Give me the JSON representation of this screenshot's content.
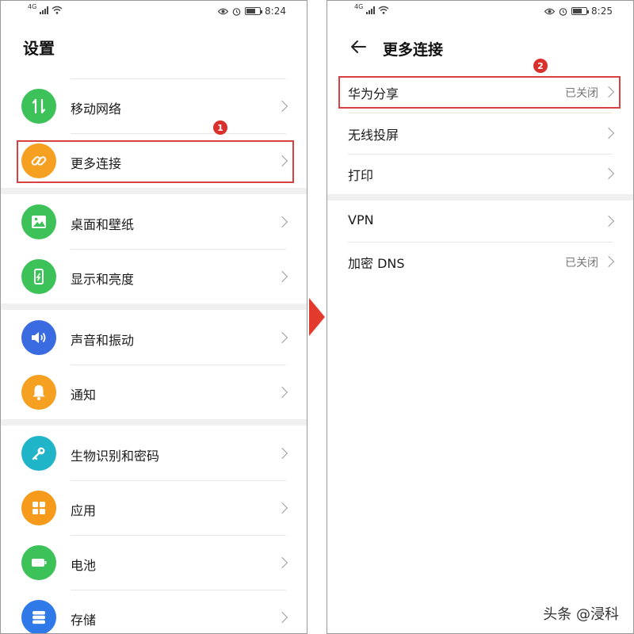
{
  "left": {
    "status": {
      "signal": "4G",
      "time": "8:24"
    },
    "title": "设置",
    "groups": [
      [
        "移动网络",
        "更多连接"
      ],
      [
        "桌面和壁纸",
        "显示和亮度"
      ],
      [
        "声音和振动",
        "通知"
      ],
      [
        "生物识别和密码",
        "应用",
        "电池",
        "存储"
      ]
    ],
    "icon_colors": {
      "mobile": "#3dc25a",
      "more": "#f5a020",
      "wallpaper": "#3dc25a",
      "display": "#3dc25a",
      "sound": "#3b6be0",
      "notify": "#f5a020",
      "bio": "#1fb4c8",
      "apps": "#f59a1a",
      "battery": "#3dc25a",
      "storage": "#2f7ae8"
    },
    "step_badge": "1"
  },
  "right": {
    "status": {
      "signal": "4G",
      "time": "8:25"
    },
    "title": "更多连接",
    "groups": [
      [
        {
          "label": "华为分享",
          "value": "已关闭"
        },
        {
          "label": "无线投屏",
          "value": ""
        },
        {
          "label": "打印",
          "value": ""
        }
      ],
      [
        {
          "label": "VPN",
          "value": ""
        },
        {
          "label": "加密 DNS",
          "value": "已关闭"
        }
      ]
    ],
    "step_badge": "2"
  },
  "watermark": "头条 @浸科",
  "accent": "#d94040"
}
